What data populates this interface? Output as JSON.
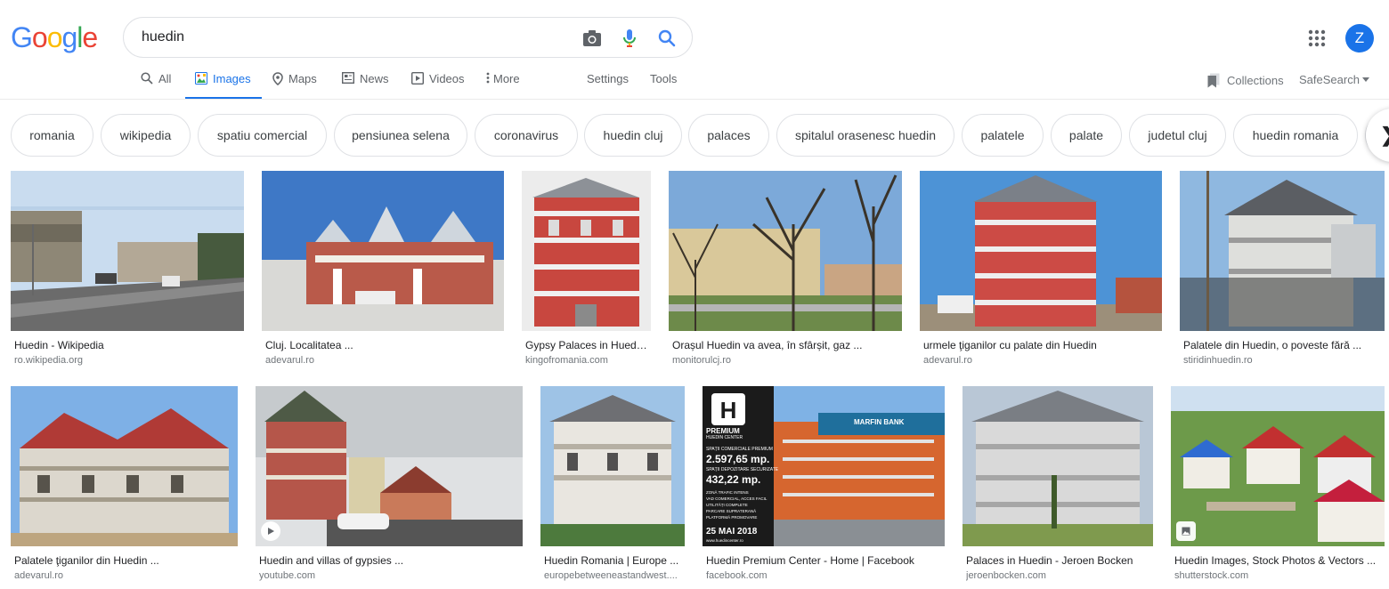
{
  "logo": {
    "letters": [
      "G",
      "o",
      "o",
      "g",
      "l",
      "e"
    ],
    "colors": [
      "#4285f4",
      "#ea4335",
      "#fbbc05",
      "#4285f4",
      "#34a853",
      "#ea4335"
    ]
  },
  "search": {
    "query": "huedin"
  },
  "icons": {
    "camera": "camera-icon",
    "mic": "mic-icon",
    "search": "search-icon",
    "apps": "apps-grid-icon"
  },
  "user": {
    "initial": "Z",
    "color": "#1a73e8"
  },
  "tabs": [
    {
      "label": "All",
      "icon": "search-icon"
    },
    {
      "label": "Images",
      "icon": "image-icon",
      "active": true
    },
    {
      "label": "Maps",
      "icon": "pin-icon"
    },
    {
      "label": "News",
      "icon": "news-icon"
    },
    {
      "label": "Videos",
      "icon": "video-icon"
    },
    {
      "label": "More",
      "icon": "dots-vertical-icon"
    },
    {
      "label": "Settings"
    },
    {
      "label": "Tools"
    }
  ],
  "right_links": {
    "collections": "Collections",
    "safesearch": "SafeSearch"
  },
  "chips": [
    "romania",
    "wikipedia",
    "spatiu comercial",
    "pensiunea selena",
    "coronavirus",
    "huedin cluj",
    "palaces",
    "spitalul orasenesc huedin",
    "palatele",
    "palate",
    "judetul cluj",
    "huedin romania"
  ],
  "results": [
    {
      "title": "Huedin - Wikipedia",
      "source": "ro.wikipedia.org"
    },
    {
      "title": "Cluj. Localitatea ...",
      "source": "adevarul.ro"
    },
    {
      "title": "Gypsy Palaces in Huedi...",
      "source": "kingofromania.com"
    },
    {
      "title": "Orașul Huedin va avea, în sfârșit, gaz ...",
      "source": "monitorulcj.ro"
    },
    {
      "title": "urmele ţiganilor cu palate din Huedin",
      "source": "adevarul.ro"
    },
    {
      "title": "Palatele din Huedin, o poveste fără ...",
      "source": "stiridinhuedin.ro"
    },
    {
      "title": "Palatele ţiganilor din Huedin ...",
      "source": "adevarul.ro"
    },
    {
      "title": "Huedin and villas of gypsies ...",
      "source": "youtube.com"
    },
    {
      "title": "Huedin Romania | Europe ...",
      "source": "europebetweeneastandwest...."
    },
    {
      "title": "Huedin Premium Center - Home | Facebook",
      "source": "facebook.com"
    },
    {
      "title": "Palaces in Huedin - Jeroen Bocken",
      "source": "jeroenbocken.com"
    },
    {
      "title": "Huedin Images, Stock Photos & Vectors ...",
      "source": "shutterstock.com"
    }
  ],
  "ad_image": {
    "brand": "PREMIUM",
    "brand_sub": "HUEDIN CENTER",
    "line1": "SPAȚII COMERCIALE PREMIUM",
    "area1": "2.597,65 mp.",
    "line2": "SPAȚII DEPOZITARE SECURIZATE",
    "area2": "432,22 mp.",
    "features": [
      "ZONĂ TRAFIC INTENS",
      "VAD COMERCIAL, ACCES FACIL",
      "UTILITĂȚI COMPLETE",
      "PARCARE SUPRATERANĂ",
      "PLATFORMĂ PROMOVARE"
    ],
    "date": "25 MAI 2018",
    "website": "www.huedincenter.ro",
    "bank_sign": "MARFIN BANK"
  }
}
